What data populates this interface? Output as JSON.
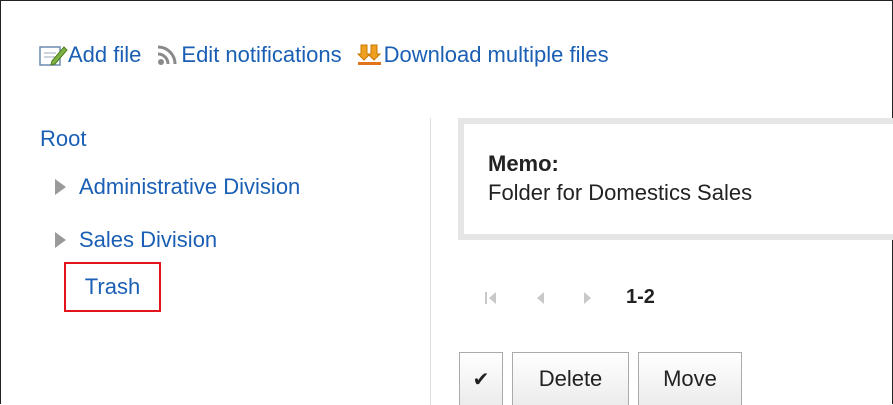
{
  "toolbar": {
    "add_file": {
      "label": "Add file",
      "icon": "add-file-icon"
    },
    "edit_notifications": {
      "label": "Edit notifications",
      "icon": "rss-icon"
    },
    "download_multiple": {
      "label": "Download multiple files",
      "icon": "download-icon"
    }
  },
  "tree": {
    "root_label": "Root",
    "items": [
      {
        "label": "Administrative Division",
        "expandable": true
      },
      {
        "label": "Sales Division",
        "expandable": true
      }
    ],
    "trash_label": "Trash",
    "highlight_color": "#e3141b"
  },
  "memo": {
    "title": "Memo:",
    "text": "Folder for Domestics Sales"
  },
  "pager": {
    "range": "1-2"
  },
  "actions": {
    "check_symbol": "✔",
    "delete_label": "Delete",
    "move_label": "Move"
  },
  "colors": {
    "link": "#1a5fb4",
    "highlight": "#e3141b"
  }
}
